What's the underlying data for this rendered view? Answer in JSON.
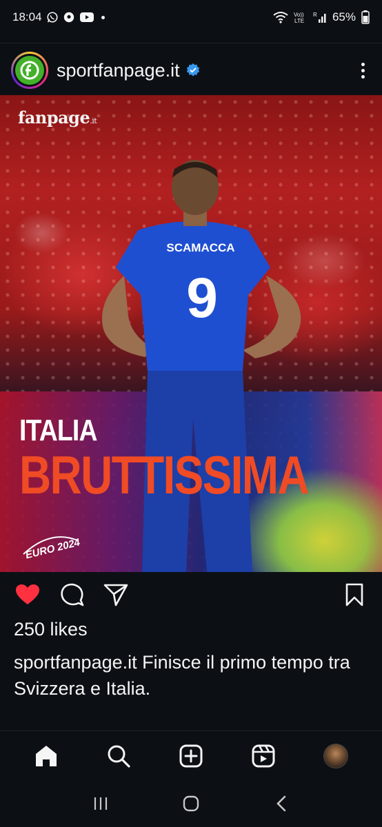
{
  "status_bar": {
    "time": "18:04",
    "battery": "65%",
    "icons": [
      "whatsapp-icon",
      "football-icon",
      "youtube-icon",
      "notification-dot",
      "wifi-icon",
      "volte-icon",
      "signal-icon",
      "battery-icon"
    ]
  },
  "post": {
    "account": {
      "username": "sportfanpage.it",
      "verified": true
    },
    "image": {
      "watermark_main": "fanpage",
      "watermark_sub": ".it",
      "jersey_name": "SCAMACCA",
      "jersey_number": "9",
      "headline_line1": "ITALIA",
      "headline_line2": "BRUTTISSIMA",
      "badge": "EURO 2024",
      "colors": {
        "headline_line2": "#ef4b25",
        "jersey": "#1f4fd1",
        "crowd": "#b22020"
      }
    },
    "liked": true,
    "likes_text": "250 likes",
    "caption_username": "sportfanpage.it",
    "caption_text": " Finisce il primo tempo tra Svizzera e Italia."
  },
  "bottom_nav": {
    "items": [
      "home-icon",
      "search-icon",
      "create-icon",
      "reels-icon",
      "profile-avatar"
    ]
  },
  "system_nav": {
    "items": [
      "recents-button",
      "home-button",
      "back-button"
    ]
  }
}
